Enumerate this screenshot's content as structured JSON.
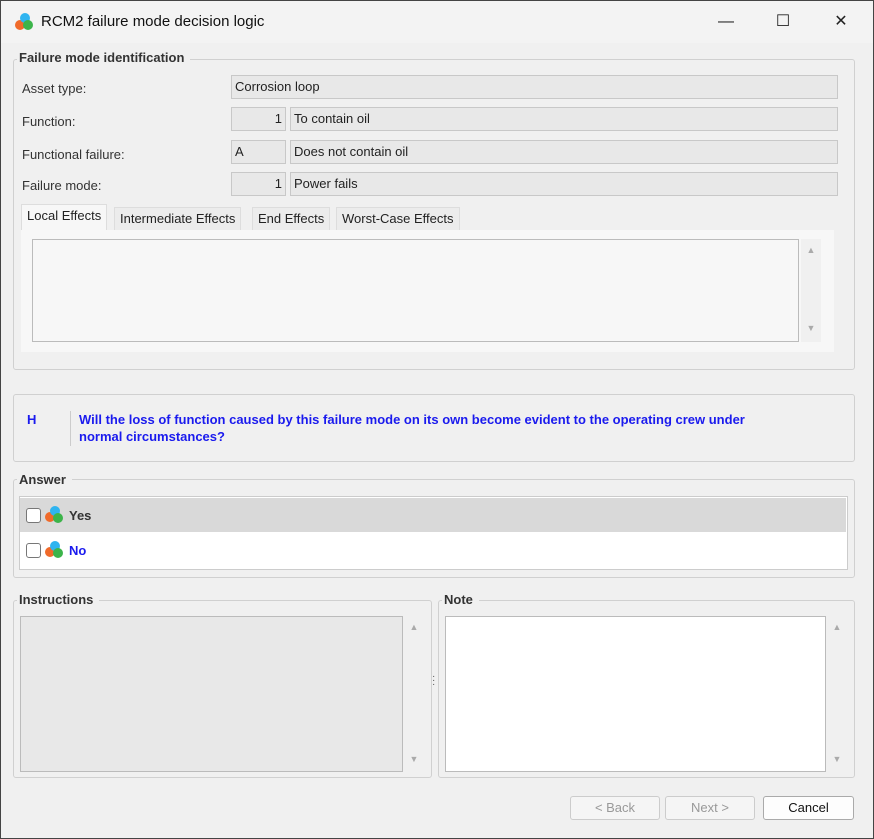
{
  "window": {
    "title": "RCM2 failure mode decision logic",
    "minimize": "—",
    "maximize": "☐",
    "close": "✕"
  },
  "identification": {
    "legend": "Failure mode identification",
    "asset_type": {
      "label": "Asset type:",
      "value": "Corrosion loop"
    },
    "function": {
      "label": "Function:",
      "code": "1",
      "value": "To contain oil"
    },
    "functional_failure": {
      "label": "Functional failure:",
      "code": "A",
      "value": "Does not contain oil"
    },
    "failure_mode": {
      "label": "Failure mode:",
      "code": "1",
      "value": "Power fails"
    },
    "tabs": [
      {
        "label": "Local Effects",
        "active": true
      },
      {
        "label": "Intermediate Effects"
      },
      {
        "label": "End Effects"
      },
      {
        "label": "Worst-Case Effects"
      }
    ],
    "effects_text": ""
  },
  "question": {
    "code": "H",
    "text": "Will the loss of function caused by this failure mode on its own become evident to the operating crew under normal circumstances?"
  },
  "answer": {
    "legend": "Answer",
    "options": [
      {
        "label": "Yes",
        "checked": false
      },
      {
        "label": "No",
        "checked": false
      }
    ]
  },
  "instructions": {
    "legend": "Instructions",
    "text": ""
  },
  "note": {
    "legend": "Note",
    "text": ""
  },
  "buttons": {
    "back": "< Back",
    "next": "Next >",
    "cancel": "Cancel"
  }
}
